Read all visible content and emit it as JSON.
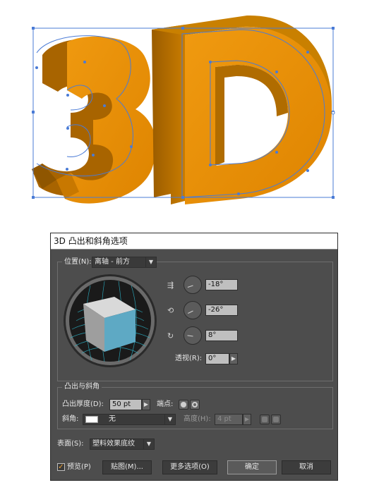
{
  "artwork": {
    "text": "3D",
    "face_color": "#e48a00",
    "side_color": "#b56e00",
    "selection_color": "#4a7bd6"
  },
  "dialog": {
    "title": "3D 凸出和斜角选项",
    "position": {
      "label": "位置(N):",
      "value": "离轴 - 前方"
    },
    "rotation": {
      "x_angle": "-18°",
      "y_angle": "-26°",
      "z_angle": "8°",
      "perspective_label": "透视(R):",
      "perspective_value": "0°"
    },
    "extrude": {
      "section_label": "凸出与斜角",
      "depth_label": "凸出厚度(D):",
      "depth_value": "50 pt",
      "cap_label": "端点:",
      "bevel_label": "斜角:",
      "bevel_value": "无",
      "height_label": "高度(H):",
      "height_value": "4 pt"
    },
    "surface": {
      "label": "表面(S):",
      "value": "塑料效果底纹"
    },
    "buttons": {
      "preview_label": "预览(P)",
      "preview_checked": true,
      "map_art": "贴图(M)...",
      "more_options": "更多选项(O)",
      "ok": "确定",
      "cancel": "取消"
    },
    "colors": {
      "cube_front": "#5ea9c4",
      "cube_top": "#d9d9d9",
      "cube_side": "#9e9e9e",
      "grid": "#2bb3c8"
    }
  }
}
